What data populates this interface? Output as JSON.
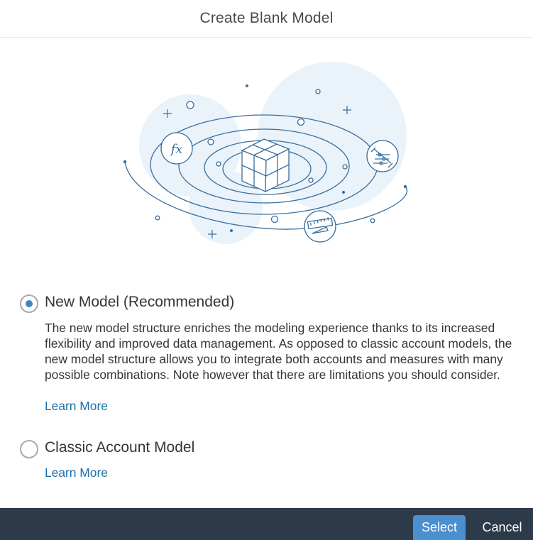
{
  "dialog": {
    "title": "Create Blank Model"
  },
  "options": [
    {
      "label": "New Model (Recommended)",
      "selected": true,
      "description": "The new model structure enriches the modeling experience thanks to its increased flexibility and improved data management. As opposed to classic account models, the new model structure allows you to integrate both accounts and measures with many possible combinations. Note however that there are limitations you should consider.",
      "link": "Learn More"
    },
    {
      "label": "Classic Account Model",
      "selected": false,
      "link": "Learn More"
    }
  ],
  "illustration": {
    "icons": [
      "cube-icon",
      "formula-fx-icon",
      "abacus-icon",
      "ruler-icon"
    ],
    "formula_text": "fx"
  },
  "footer": {
    "select_label": "Select",
    "cancel_label": "Cancel"
  },
  "colors": {
    "accent": "#3f86c6",
    "link": "#1d6fa9",
    "footer_bg": "#2d3a49",
    "select_bg": "#4a90cf",
    "illustration_bg": "#eaf2fa",
    "illustration_line": "#3a6f9e"
  }
}
